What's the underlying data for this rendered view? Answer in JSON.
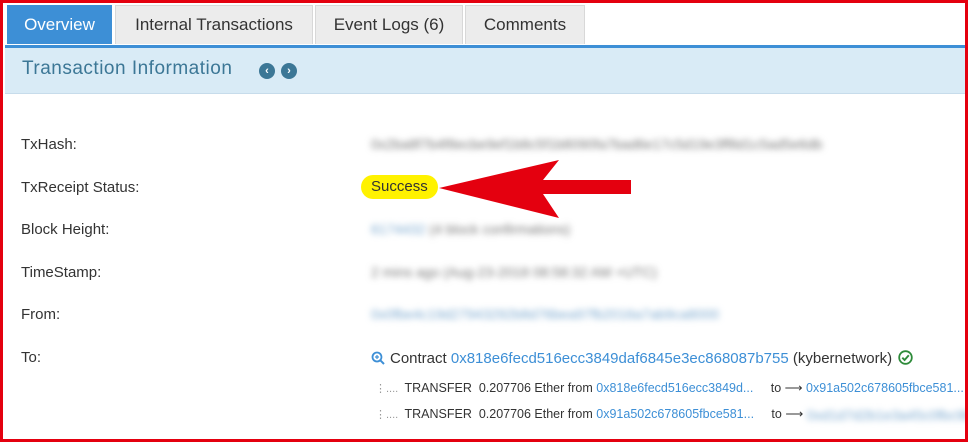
{
  "tabs": [
    {
      "label": "Overview",
      "active": true
    },
    {
      "label": "Internal Transactions",
      "active": false
    },
    {
      "label": "Event Logs (6)",
      "active": false
    },
    {
      "label": "Comments",
      "active": false
    }
  ],
  "section": {
    "title": "Transaction Information",
    "prev_icon": "chevron-left-icon",
    "next_icon": "chevron-right-icon"
  },
  "fields": {
    "txhash_label": "TxHash:",
    "status_label": "TxReceipt Status:",
    "status_value": "Success",
    "block_label": "Block Height:",
    "timestamp_label": "TimeStamp:",
    "from_label": "From:",
    "to_label": "To:"
  },
  "to": {
    "contract_prefix": "Contract",
    "contract_address": "0x818e6fecd516ecc3849daf6845e3ec868087b755",
    "contract_name": "(kybernetwork)",
    "transfers": [
      {
        "type": "TRANSFER",
        "amount": "0.207706 Ether from",
        "from": "0x818e6fecd516ecc3849d...",
        "to_label": "to",
        "to": "0x91a502c678605fbce581..."
      },
      {
        "type": "TRANSFER",
        "amount": "0.207706 Ether from",
        "from": "0x91a502c678605fbce581...",
        "to_label": "to",
        "to": ""
      }
    ]
  },
  "colors": {
    "frame": "#e4000f",
    "tab_active": "#3d8fd6",
    "section_bg": "#d9ebf6",
    "link": "#3d8fd6",
    "badge": "#fff200",
    "arrow": "#e4000f"
  }
}
